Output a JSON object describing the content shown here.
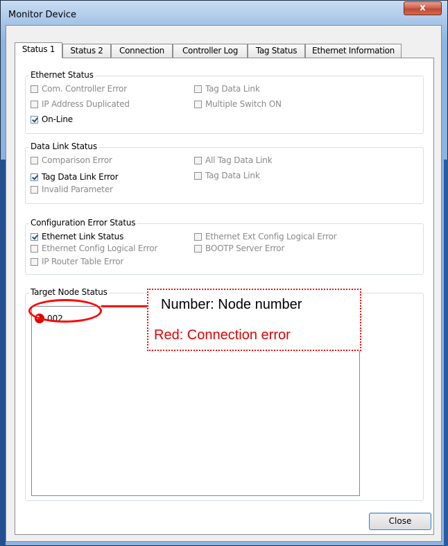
{
  "window": {
    "title": "Monitor Device",
    "close_glyph": "x"
  },
  "tabs": [
    {
      "label": "Status 1",
      "active": true
    },
    {
      "label": "Status 2"
    },
    {
      "label": "Connection"
    },
    {
      "label": "Controller Log"
    },
    {
      "label": "Tag Status"
    },
    {
      "label": "Ethernet Information"
    }
  ],
  "ethernet_status": {
    "legend": "Ethernet Status",
    "items": [
      {
        "label": "Com. Controller Error",
        "checked": false,
        "enabled": false
      },
      {
        "label": "Tag Data Link",
        "checked": false,
        "enabled": false
      },
      {
        "label": "IP Address Duplicated",
        "checked": false,
        "enabled": false
      },
      {
        "label": "Multiple Switch ON",
        "checked": false,
        "enabled": false
      },
      {
        "label": "On-Line",
        "checked": true,
        "enabled": true
      }
    ]
  },
  "data_link_status": {
    "legend": "Data Link Status",
    "items": [
      {
        "label": "Comparison Error",
        "checked": false,
        "enabled": false
      },
      {
        "label": "All Tag Data Link",
        "checked": false,
        "enabled": false
      },
      {
        "label": "Tag Data Link Error",
        "checked": true,
        "enabled": true
      },
      {
        "label": "Tag Data Link",
        "checked": false,
        "enabled": false
      },
      {
        "label": "Invalid Parameter",
        "checked": false,
        "enabled": false
      }
    ]
  },
  "configuration_error_status": {
    "legend": "Configuration Error Status",
    "items": [
      {
        "label": "Ethernet Link Status",
        "checked": true,
        "enabled": true
      },
      {
        "label": "Ethernet Ext Config Logical Error",
        "checked": false,
        "enabled": false
      },
      {
        "label": "Ethernet Config Logical Error",
        "checked": false,
        "enabled": false
      },
      {
        "label": "BOOTP Server Error",
        "checked": false,
        "enabled": false
      },
      {
        "label": "IP Router Table Error",
        "checked": false,
        "enabled": false
      }
    ]
  },
  "target_node_status": {
    "legend": "Target Node Status",
    "nodes": [
      {
        "number": "002",
        "status_color": "#e00000"
      }
    ]
  },
  "buttons": {
    "close": "Close"
  },
  "annotation": {
    "line1": "Number: Node number",
    "line2": "Red: Connection error",
    "color": "#ff0000"
  }
}
